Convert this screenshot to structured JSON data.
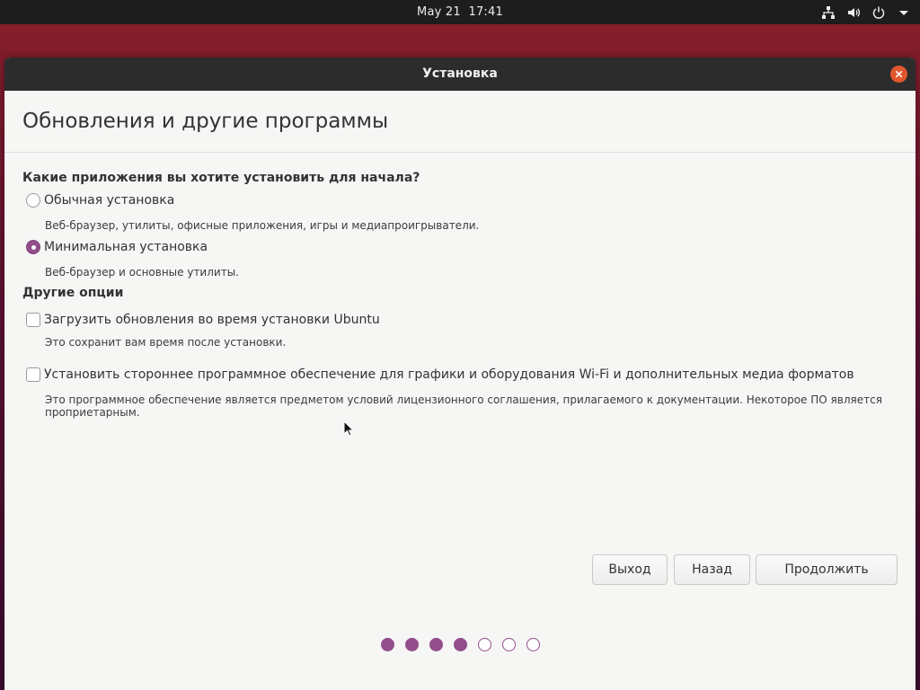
{
  "topbar": {
    "date": "May 21",
    "time": "17:41",
    "icons": [
      "network-icon",
      "volume-icon",
      "power-icon",
      "chevron-down-icon"
    ]
  },
  "window": {
    "title": "Установка",
    "close_icon": "close-icon"
  },
  "page": {
    "title": "Обновления и другие программы"
  },
  "install_type": {
    "heading": "Какие приложения вы хотите установить для начала?",
    "options": [
      {
        "label": "Обычная установка",
        "description": "Веб-браузер, утилиты, офисные приложения, игры и медиапроигрыватели.",
        "checked": false
      },
      {
        "label": "Минимальная установка",
        "description": "Веб-браузер и основные утилиты.",
        "checked": true
      }
    ]
  },
  "other_options": {
    "heading": "Другие опции",
    "items": [
      {
        "label": "Загрузить обновления во время установки Ubuntu",
        "description": "Это сохранит вам время после установки.",
        "checked": false
      },
      {
        "label": "Установить стороннее программное обеспечение для графики и оборудования Wi-Fi и дополнительных медиа форматов",
        "description": "Это программное обеспечение является предметом условий лицензионного соглашения, прилагаемого к документации. Некоторое ПО является проприетарным.",
        "checked": false
      }
    ]
  },
  "buttons": {
    "quit": "Выход",
    "back": "Назад",
    "continue": "Продолжить"
  },
  "progress": {
    "total_steps": 7,
    "completed_steps": 4
  },
  "colors": {
    "accent": "#924d8b",
    "close": "#e0562e",
    "titlebar": "#2c2c2c",
    "topbar": "#1d1d1d"
  }
}
